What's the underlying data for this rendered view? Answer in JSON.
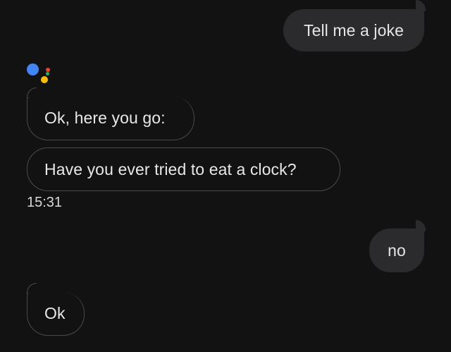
{
  "conversation": {
    "messages": [
      {
        "sender": "user",
        "text": "Tell me a joke"
      },
      {
        "sender": "assistant",
        "text": "Ok, here you go:"
      },
      {
        "sender": "assistant",
        "text": "Have you ever tried to eat a clock?"
      },
      {
        "sender": "user",
        "text": "no"
      },
      {
        "sender": "assistant",
        "text": "Ok"
      }
    ],
    "timestamp": "15:31"
  },
  "assistant_logo": {
    "icon": "google-assistant-dots-icon",
    "colors": {
      "blue": "#4285F4",
      "red": "#EA4335",
      "yellow": "#FBBC05",
      "green": "#34A853"
    }
  },
  "theme": {
    "background": "#121212",
    "user_bubble": "#2b2b2d",
    "assistant_border": "#4a4a4c",
    "text": "#e6e6e6"
  }
}
